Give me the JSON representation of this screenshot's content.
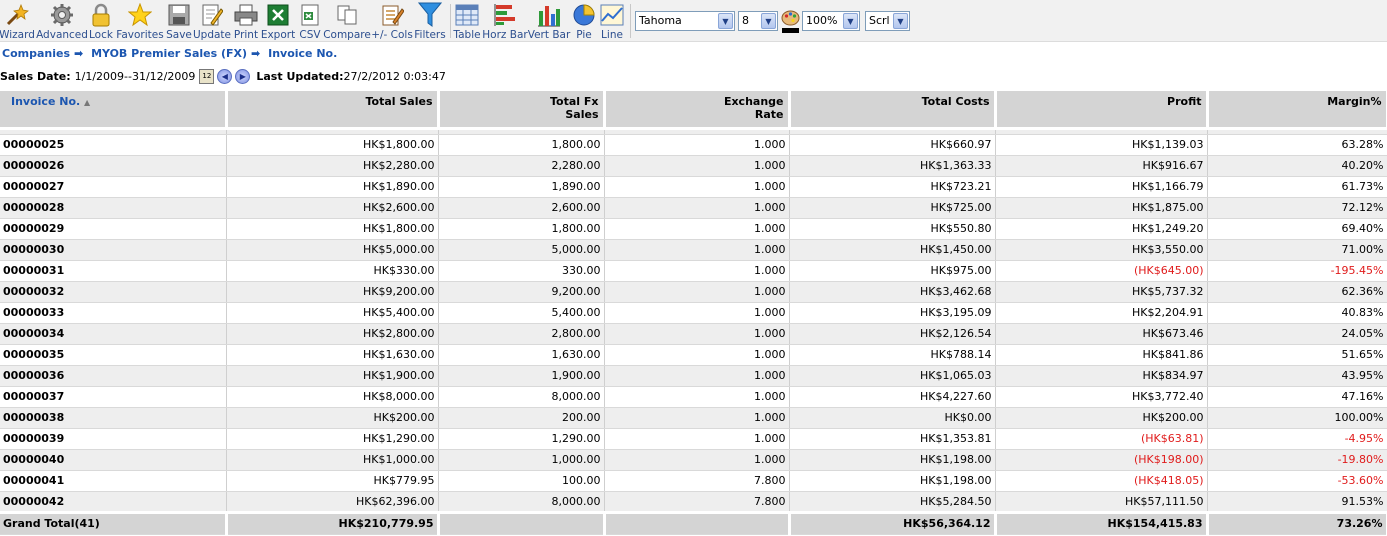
{
  "toolbar": {
    "buttons": [
      {
        "label": "Wizard",
        "icon": "wizard-icon"
      },
      {
        "label": "Advanced",
        "icon": "gear-icon"
      },
      {
        "label": "Lock",
        "icon": "lock-icon"
      },
      {
        "label": "Favorites",
        "icon": "star-icon"
      },
      {
        "label": "Save",
        "icon": "save-icon"
      },
      {
        "label": "Update",
        "icon": "edit-icon"
      },
      {
        "label": "Print",
        "icon": "printer-icon"
      },
      {
        "label": "Export",
        "icon": "excel-icon"
      },
      {
        "label": "CSV",
        "icon": "csv-icon"
      },
      {
        "label": "Compare",
        "icon": "compare-icon"
      },
      {
        "label": "+/- Cols",
        "icon": "columns-icon"
      },
      {
        "label": "Filters",
        "icon": "filter-icon"
      },
      {
        "label": "Table",
        "icon": "table-icon"
      },
      {
        "label": "Horz Bar",
        "icon": "horizontal-bar-chart-icon"
      },
      {
        "label": "Vert Bar",
        "icon": "vertical-bar-chart-icon"
      },
      {
        "label": "Pie",
        "icon": "pie-chart-icon"
      },
      {
        "label": "Line",
        "icon": "line-chart-icon"
      }
    ],
    "font": "Tahoma",
    "font_size": "8",
    "zoom": "100%",
    "scroll_mode": "Scrl"
  },
  "breadcrumb": [
    "Companies",
    "MYOB Premier Sales (FX)",
    "Invoice No."
  ],
  "sales_date_label": "Sales Date:",
  "sales_date_value": "1/1/2009--31/12/2009",
  "last_updated_label": "Last Updated:",
  "last_updated_value": "27/2/2012 0:03:47",
  "table": {
    "headers": [
      "Invoice No.",
      "Total Sales",
      "Total Fx Sales",
      "Exchange Rate",
      "Total Costs",
      "Profit",
      "Margin%"
    ],
    "rows": [
      [
        "00000025",
        "HK$1,800.00",
        "1,800.00",
        "1.000",
        "HK$660.97",
        "HK$1,139.03",
        "63.28%"
      ],
      [
        "00000026",
        "HK$2,280.00",
        "2,280.00",
        "1.000",
        "HK$1,363.33",
        "HK$916.67",
        "40.20%"
      ],
      [
        "00000027",
        "HK$1,890.00",
        "1,890.00",
        "1.000",
        "HK$723.21",
        "HK$1,166.79",
        "61.73%"
      ],
      [
        "00000028",
        "HK$2,600.00",
        "2,600.00",
        "1.000",
        "HK$725.00",
        "HK$1,875.00",
        "72.12%"
      ],
      [
        "00000029",
        "HK$1,800.00",
        "1,800.00",
        "1.000",
        "HK$550.80",
        "HK$1,249.20",
        "69.40%"
      ],
      [
        "00000030",
        "HK$5,000.00",
        "5,000.00",
        "1.000",
        "HK$1,450.00",
        "HK$3,550.00",
        "71.00%"
      ],
      [
        "00000031",
        "HK$330.00",
        "330.00",
        "1.000",
        "HK$975.00",
        "(HK$645.00)",
        "-195.45%"
      ],
      [
        "00000032",
        "HK$9,200.00",
        "9,200.00",
        "1.000",
        "HK$3,462.68",
        "HK$5,737.32",
        "62.36%"
      ],
      [
        "00000033",
        "HK$5,400.00",
        "5,400.00",
        "1.000",
        "HK$3,195.09",
        "HK$2,204.91",
        "40.83%"
      ],
      [
        "00000034",
        "HK$2,800.00",
        "2,800.00",
        "1.000",
        "HK$2,126.54",
        "HK$673.46",
        "24.05%"
      ],
      [
        "00000035",
        "HK$1,630.00",
        "1,630.00",
        "1.000",
        "HK$788.14",
        "HK$841.86",
        "51.65%"
      ],
      [
        "00000036",
        "HK$1,900.00",
        "1,900.00",
        "1.000",
        "HK$1,065.03",
        "HK$834.97",
        "43.95%"
      ],
      [
        "00000037",
        "HK$8,000.00",
        "8,000.00",
        "1.000",
        "HK$4,227.60",
        "HK$3,772.40",
        "47.16%"
      ],
      [
        "00000038",
        "HK$200.00",
        "200.00",
        "1.000",
        "HK$0.00",
        "HK$200.00",
        "100.00%"
      ],
      [
        "00000039",
        "HK$1,290.00",
        "1,290.00",
        "1.000",
        "HK$1,353.81",
        "(HK$63.81)",
        "-4.95%"
      ],
      [
        "00000040",
        "HK$1,000.00",
        "1,000.00",
        "1.000",
        "HK$1,198.00",
        "(HK$198.00)",
        "-19.80%"
      ],
      [
        "00000041",
        "HK$779.95",
        "100.00",
        "7.800",
        "HK$1,198.00",
        "(HK$418.05)",
        "-53.60%"
      ],
      [
        "00000042",
        "HK$62,396.00",
        "8,000.00",
        "7.800",
        "HK$5,284.50",
        "HK$57,111.50",
        "91.53%"
      ]
    ],
    "negative_color": "#e01b1b",
    "total": [
      "Grand Total(41)",
      "HK$210,779.95",
      "",
      "",
      "HK$56,364.12",
      "HK$154,415.83",
      "73.26%"
    ]
  }
}
